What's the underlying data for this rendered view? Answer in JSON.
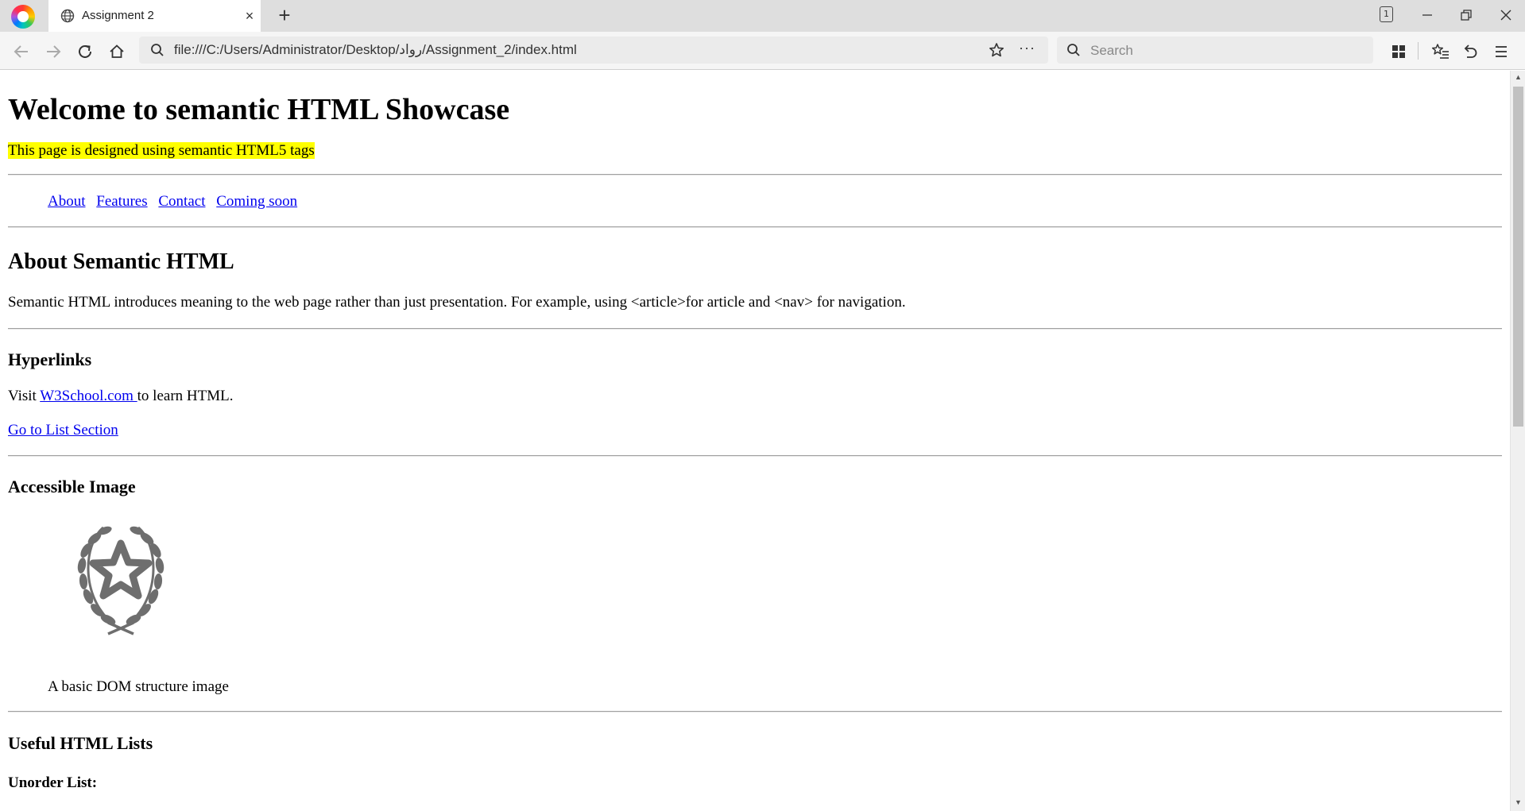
{
  "browser": {
    "tab": {
      "title": "Assignment 2",
      "close": "×"
    },
    "new_tab": "+",
    "tab_count": "1",
    "url": "file:///C:/Users/Administrator/Desktop/رواد/Assignment_2/index.html",
    "search_placeholder": "Search",
    "more_menu": "···"
  },
  "page": {
    "title": "Welcome to semantic HTML Showcase",
    "subtitle": "This page is designed using semantic HTML5 tags",
    "nav": [
      "About",
      "Features",
      "Contact",
      "Coming soon"
    ],
    "about": {
      "heading": "About Semantic HTML",
      "text": "Semantic HTML introduces meaning to the web page rather than just presentation. For example, using <article>for article and <nav> for navigation."
    },
    "hyperlinks": {
      "heading": "Hyperlinks",
      "visit_prefix": "Visit ",
      "link_text": "W3School.com ",
      "visit_suffix": "to learn HTML.",
      "list_link": "Go to List Section"
    },
    "image_section": {
      "heading": "Accessible Image",
      "caption": "A basic DOM structure image"
    },
    "lists": {
      "heading": "Useful HTML Lists",
      "unordered_label": "Unorder List:"
    }
  },
  "icons": {
    "tab_favicon": "globe-icon",
    "figure_image": "laurel-star-icon"
  }
}
